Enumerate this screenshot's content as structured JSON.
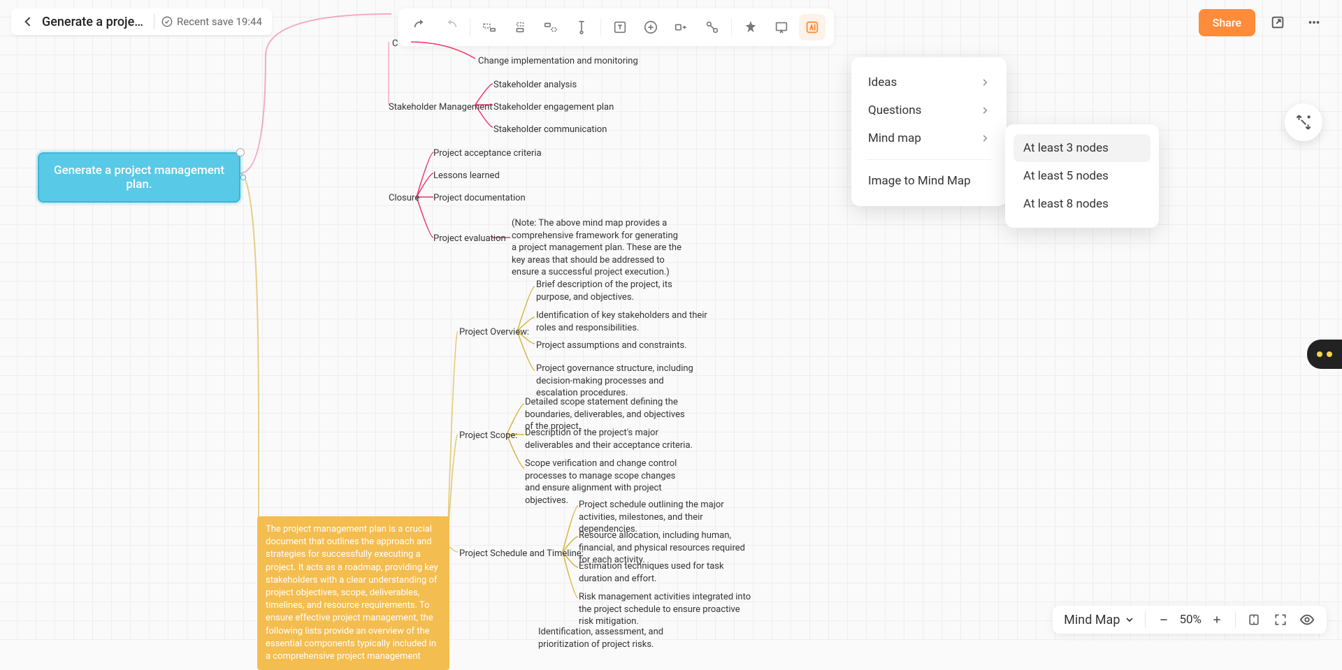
{
  "header": {
    "title": "Generate a projec…",
    "saveStatus": "Recent save 19:44",
    "shareLabel": "Share"
  },
  "rootNode": "Generate a project management plan.",
  "aiMenu": {
    "ideas": "Ideas",
    "questions": "Questions",
    "mindmap": "Mind map",
    "imageToMap": "Image to Mind Map"
  },
  "aiSubmenu": {
    "n3": "At least 3 nodes",
    "n5": "At least 5 nodes",
    "n8": "At least 8 nodes"
  },
  "nodes": {
    "changeRoot": "C",
    "changeImpl": "Change implementation and monitoring",
    "stakeholderMgmt": "Stakeholder Management",
    "sh1": "Stakeholder analysis",
    "sh2": "Stakeholder engagement plan",
    "sh3": "Stakeholder communication",
    "closure": "Closure",
    "cl1": "Project acceptance criteria",
    "cl2": "Lessons learned",
    "cl3": "Project documentation",
    "cl4": "Project evaluation",
    "cl4note": "(Note: The above mind map provides a comprehensive framework for generating a project management plan. These are the key areas that should be addressed to ensure a successful project execution.)",
    "overview": "Project Overview:",
    "ov1": "Brief description of the project, its purpose, and objectives.",
    "ov2": "Identification of key stakeholders and their roles and responsibilities.",
    "ov3": "Project assumptions and constraints.",
    "ov4": "Project governance structure, including decision-making processes and escalation procedures.",
    "scope": "Project Scope:",
    "sc1": "Detailed scope statement defining the boundaries, deliverables, and objectives of the project.",
    "sc2": "Description of the project's major deliverables and their acceptance criteria.",
    "sc3": "Scope verification and change control processes to manage scope changes and ensure alignment with project objectives.",
    "schedule": "Project Schedule and Timeline:",
    "st1": "Project schedule outlining the major activities, milestones, and their dependencies.",
    "st2": "Resource allocation, including human, financial, and physical resources required for each activity.",
    "st3": "Estimation techniques used for task duration and effort.",
    "st4": "Risk management activities integrated into the project schedule to ensure proactive risk mitigation.",
    "risks": "Identification, assessment, and prioritization of project risks."
  },
  "descBox": "The project management plan is a crucial document that outlines the approach and strategies for successfully executing a project. It acts as a roadmap, providing key stakeholders with a clear understanding of project objectives, scope, deliverables, timelines, and resource requirements. To ensure effective project management, the following lists provide an overview of the essential components typically included in a comprehensive project management",
  "bottomBar": {
    "mode": "Mind Map",
    "zoom": "50%"
  },
  "colors": {
    "accent": "#ff8c3a",
    "rootNode": "#58c9e6",
    "descBox": "#f4bd4f"
  }
}
